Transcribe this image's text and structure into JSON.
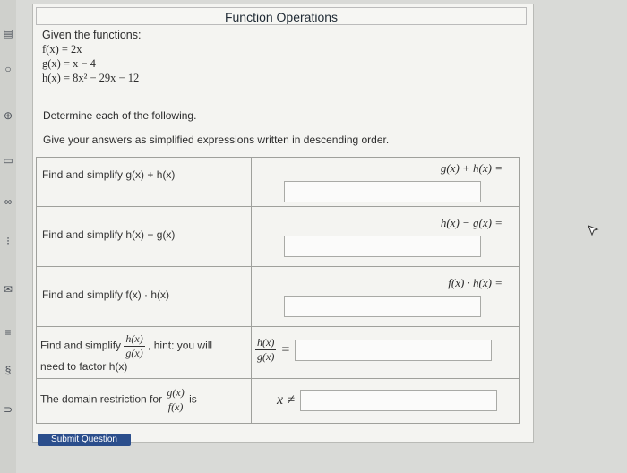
{
  "title": "Function Operations",
  "given": {
    "label": "Given the functions:",
    "f": "f(x) = 2x",
    "g": "g(x) = x − 4",
    "h": "h(x) = 8x² − 29x − 12"
  },
  "instructions": {
    "line1": "Determine each of the following.",
    "line2": "Give your answers as simplified expressions written in descending order."
  },
  "rows": [
    {
      "prompt": "Find and simplify g(x) + h(x)",
      "answer_label": "g(x) + h(x) ="
    },
    {
      "prompt": "Find and simplify h(x) − g(x)",
      "answer_label": "h(x) − g(x) ="
    },
    {
      "prompt": "Find and simplify f(x) · h(x)",
      "answer_label": "f(x) · h(x) ="
    }
  ],
  "quotient": {
    "prompt_prefix": "Find and simplify",
    "num": "h(x)",
    "den": "g(x)",
    "hint": ", hint: you will",
    "hint2": "need to factor h(x)"
  },
  "domain": {
    "prompt": "The domain restriction for",
    "num": "g(x)",
    "den": "f(x)",
    "is": "is",
    "var": "x ≠"
  },
  "submit": "Submit Question"
}
